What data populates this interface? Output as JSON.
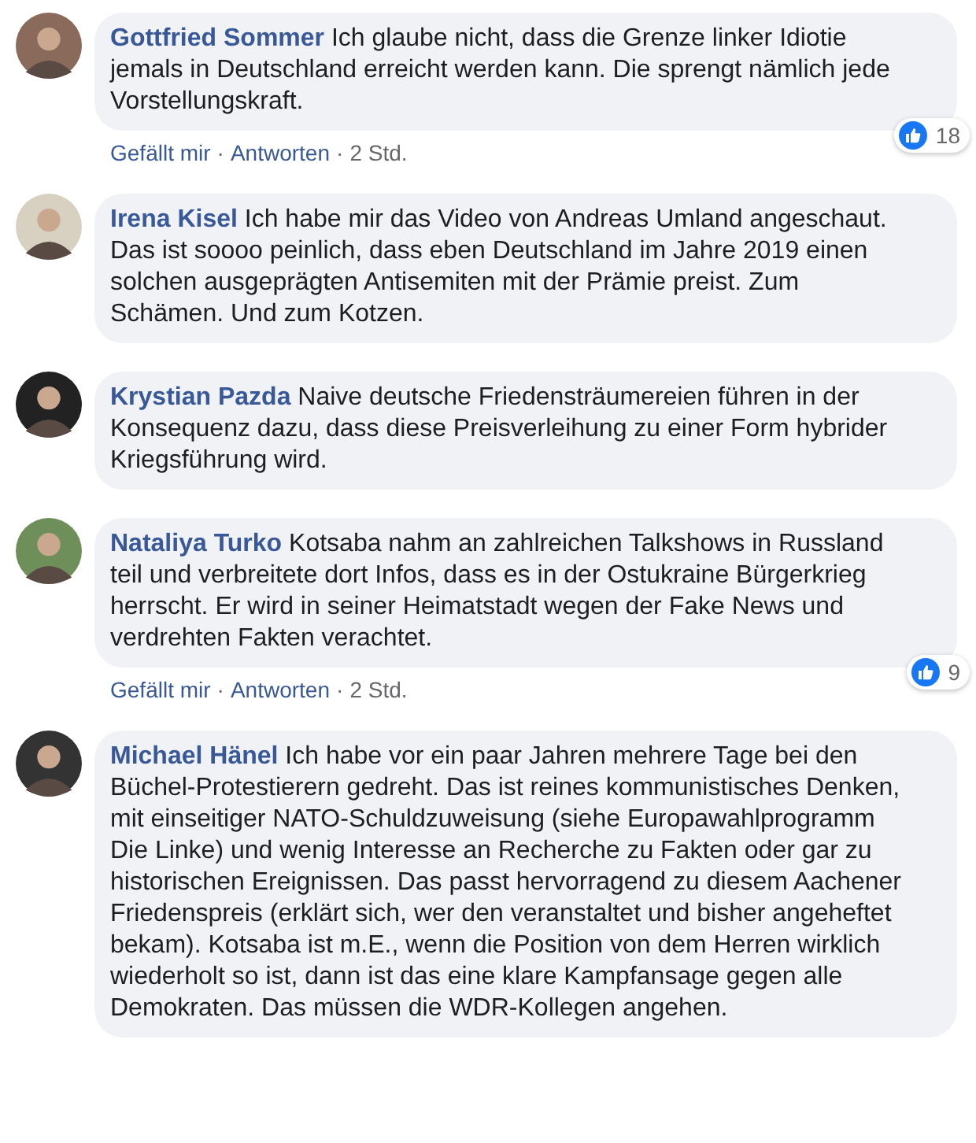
{
  "comments": [
    {
      "author": "Gottfried Sommer",
      "text": "Ich glaube nicht, dass die Grenze linker Idiotie jemals in Deutschland erreicht werden kann. Die sprengt nämlich jede Vorstellungskraft.",
      "actions": [
        "Gefällt mir",
        "Antworten"
      ],
      "separator": "·",
      "time": "2 Std.",
      "likes": "18"
    },
    {
      "author": "Irena Kisel",
      "text": "Ich habe mir das Video von Andreas Umland angeschaut. Das ist soooo peinlich, dass eben Deutschland im Jahre 2019 einen solchen ausgeprägten Antisemiten mit der Prämie preist. Zum Schämen. Und zum Kotzen."
    },
    {
      "author": "Krystian Pazda",
      "text": "Naive deutsche Friedensträumereien führen in der Konsequenz dazu, dass diese Preisverleihung zu einer Form hybrider Kriegsführung wird."
    },
    {
      "author": "Nataliya Turko",
      "text": "Kotsaba nahm an zahlreichen Talkshows in Russland teil und verbreitete dort Infos, dass es in der Ostukraine Bürgerkrieg herrscht. Er wird in seiner Heimatstadt wegen der Fake News und verdrehten Fakten verachtet.",
      "actions": [
        "Gefällt mir",
        "Antworten"
      ],
      "separator": "·",
      "time": "2 Std.",
      "likes": "9"
    },
    {
      "author": "Michael Hänel",
      "text": "Ich habe vor ein paar Jahren mehrere Tage bei den Büchel-Protestierern gedreht. Das ist reines kommunistisches Denken, mit einseitiger NATO-Schuldzuweisung (siehe Europawahlprogramm Die Linke) und wenig Interesse an Recherche zu Fakten oder gar zu historischen Ereignissen. Das passt hervorragend zu diesem Aachener Friedenspreis (erklärt sich, wer den veranstaltet und bisher angeheftet bekam). Kotsaba ist m.E., wenn die Position von dem Herren wirklich wiederholt so ist, dann ist das eine klare Kampfansage gegen alle Demokraten. Das müssen die WDR-Kollegen angehen."
    }
  ]
}
